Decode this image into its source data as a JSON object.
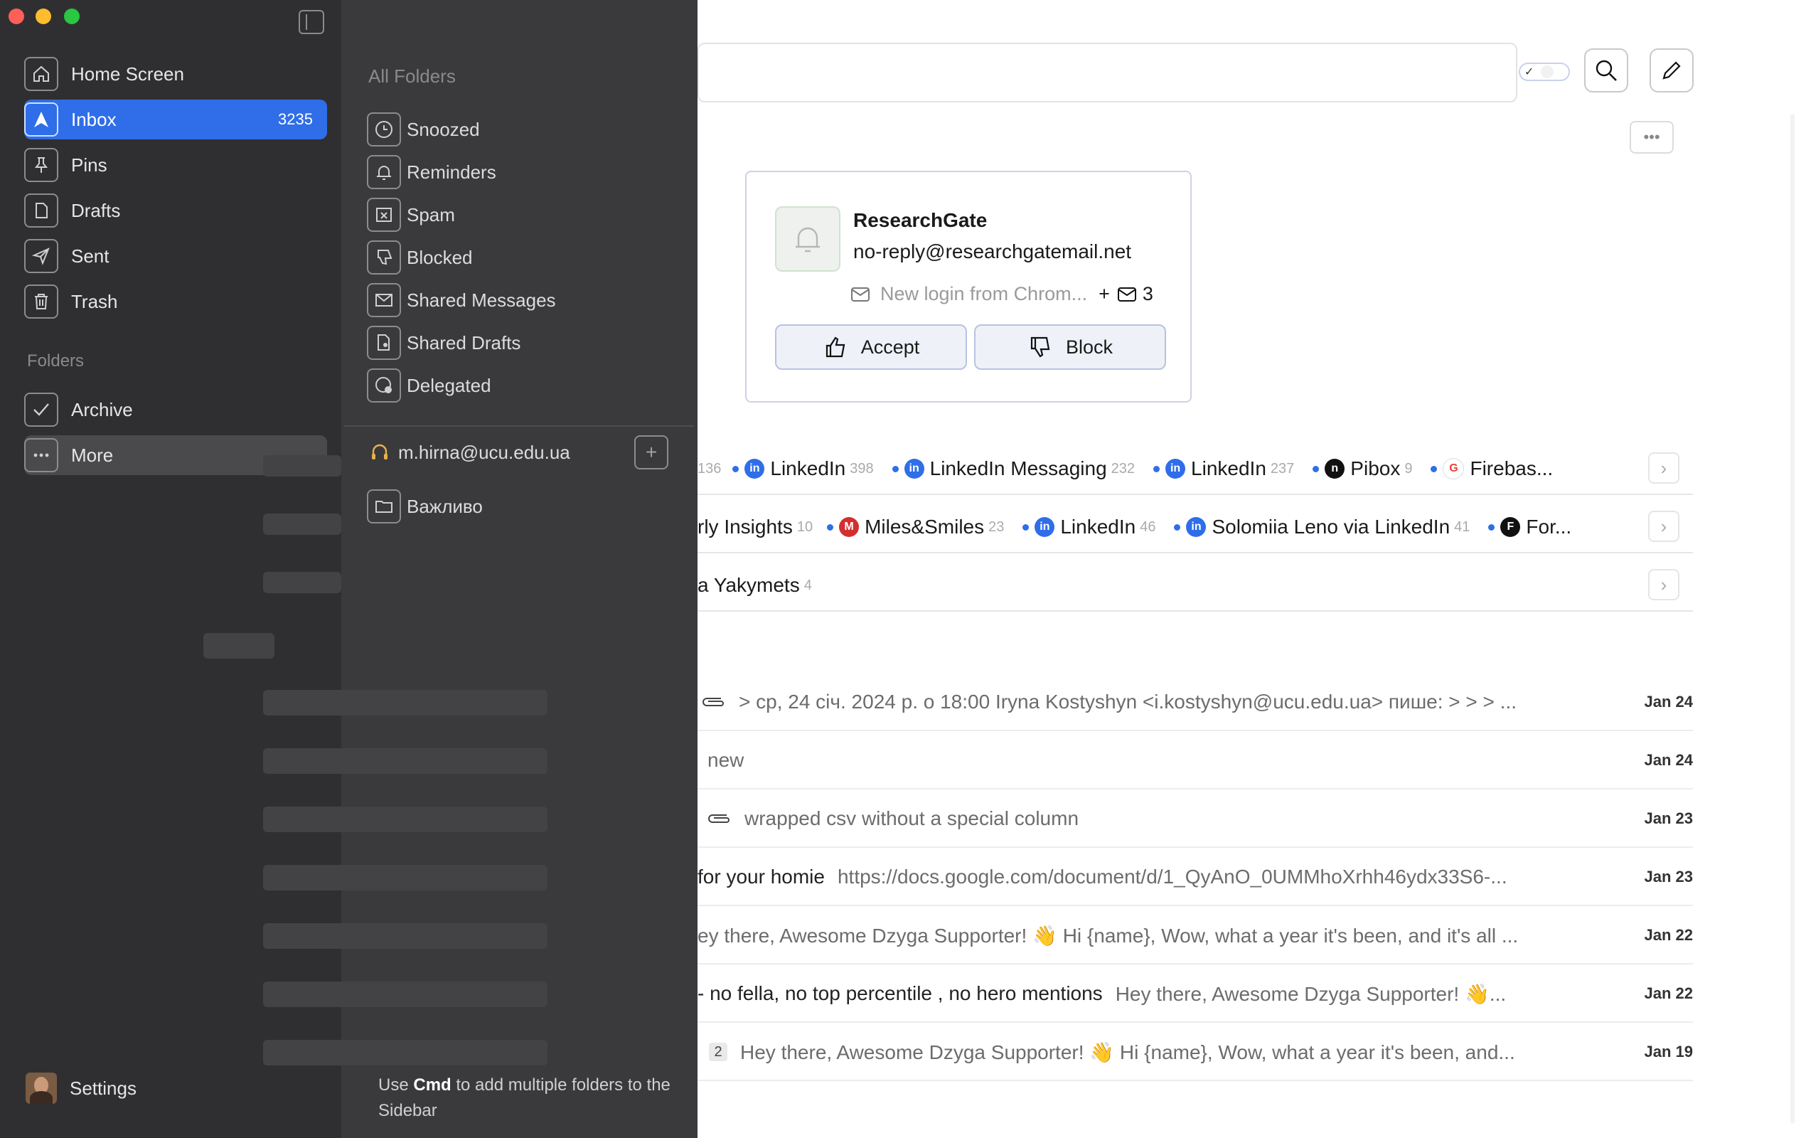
{
  "window": {
    "traffic_lights": [
      "#ff5f57",
      "#febc2e",
      "#28c840"
    ]
  },
  "rail": {
    "items": [
      {
        "label": "Home Screen",
        "icon": "home-icon",
        "count": ""
      },
      {
        "label": "Inbox",
        "icon": "inbox-icon",
        "count": "3235"
      },
      {
        "label": "Pins",
        "icon": "pin-icon",
        "count": ""
      },
      {
        "label": "Drafts",
        "icon": "drafts-icon",
        "count": ""
      },
      {
        "label": "Sent",
        "icon": "sent-icon",
        "count": ""
      },
      {
        "label": "Trash",
        "icon": "trash-icon",
        "count": ""
      }
    ],
    "folders_heading": "Folders",
    "archive": "Archive",
    "more": "More",
    "settings": "Settings"
  },
  "folders_panel": {
    "heading": "All Folders",
    "items": [
      "Snoozed",
      "Reminders",
      "Spam",
      "Blocked",
      "Shared Messages",
      "Shared Drafts",
      "Delegated"
    ],
    "account": "m.hirna@ucu.edu.ua",
    "custom_folder": "Важливо",
    "hint_prefix": "Use ",
    "hint_key": "Cmd",
    "hint_suffix": " to add multiple folders to the Sidebar"
  },
  "card": {
    "sender": "ResearchGate",
    "email": "no-reply@researchgatemail.net",
    "preview": "New login from Chrom...",
    "plus": "+",
    "extra_count": "3",
    "accept": "Accept",
    "block": "Block"
  },
  "chip_rows": [
    {
      "lead_count": "136",
      "chips": [
        {
          "name": "LinkedIn",
          "count": "398",
          "avatar": "in",
          "color": "#2f6ee8"
        },
        {
          "name": "LinkedIn Messaging",
          "count": "232",
          "avatar": "in",
          "color": "#2f6ee8"
        },
        {
          "name": "LinkedIn",
          "count": "237",
          "avatar": "in",
          "color": "#2f6ee8"
        },
        {
          "name": "Pibox",
          "count": "9",
          "avatar": "n",
          "color": "#111111"
        },
        {
          "name": "Firebas...",
          "count": "",
          "avatar": "G",
          "color": "#ea4335"
        }
      ]
    },
    {
      "lead_text": "rly Insights",
      "lead_count": "10",
      "chips": [
        {
          "name": "Miles&Smiles",
          "count": "23",
          "avatar": "M",
          "color": "#d32f2f"
        },
        {
          "name": "LinkedIn",
          "count": "46",
          "avatar": "in",
          "color": "#2f6ee8"
        },
        {
          "name": "Solomiia Leno via LinkedIn",
          "count": "41",
          "avatar": "in",
          "color": "#2f6ee8"
        },
        {
          "name": "For...",
          "count": "",
          "avatar": "F",
          "color": "#111111"
        }
      ]
    },
    {
      "lead_text": "a Yakymets",
      "lead_count": "4",
      "chips": []
    }
  ],
  "emails": [
    {
      "subject": "",
      "snippet": "> ср, 24 січ. 2024 р. о 18:00 Iryna Kostyshyn <i.kostyshyn@ucu.edu.ua> пише: > > > ...",
      "date": "Jan 24",
      "attachment": true
    },
    {
      "subject": "",
      "snippet": "new",
      "date": "Jan 24",
      "attachment": false
    },
    {
      "subject": "",
      "snippet": "wrapped csv without a special column",
      "date": "Jan 23",
      "attachment": true
    },
    {
      "subject": "for your homie",
      "snippet": "https://docs.google.com/document/d/1_QyAnO_0UMMhoXrhh46ydx33S6-...",
      "date": "Jan 23",
      "attachment": false
    },
    {
      "subject": "",
      "snippet": "ey there, Awesome Dzyga Supporter! 👋 Hi {name}, Wow, what a year it's been, and it's all ...",
      "date": "Jan 22",
      "attachment": false
    },
    {
      "subject": "- no fella, no top percentile , no hero mentions",
      "snippet": "Hey there, Awesome Dzyga Supporter! 👋...",
      "date": "Jan 22",
      "attachment": false
    },
    {
      "subject": "",
      "badge": "2",
      "snippet": "Hey there, Awesome Dzyga Supporter! 👋 Hi {name}, Wow, what a year it's been, and...",
      "date": "Jan 19",
      "attachment": false
    }
  ]
}
